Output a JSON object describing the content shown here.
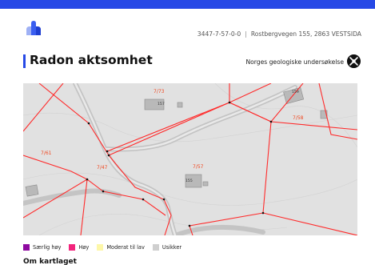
{
  "header": {
    "logo_icon": "cloud-bars-logo-icon",
    "property_id": "3447-7-57-0-0",
    "separator": "|",
    "address": "Rostbergvegen 155, 2863 VESTSIDA"
  },
  "section": {
    "title": "Radon aktsomhet",
    "source": "Norges geologiske undersøkelse",
    "source_icon": "ngu-logo-icon"
  },
  "map": {
    "parcel_labels": [
      "7/73",
      "7/58",
      "7/61",
      "7/47",
      "7/57"
    ],
    "building_labels": [
      "157",
      "159",
      "155"
    ],
    "boundary_color": "#ff2b2b",
    "label_color": "#f04a23",
    "background_color": "#e1e1e1"
  },
  "legend": {
    "items": [
      {
        "label": "Særlig høy",
        "color": "#8e0aa0"
      },
      {
        "label": "Høy",
        "color": "#f2247c"
      },
      {
        "label": "Moderat til lav",
        "color": "#fdf7a8"
      },
      {
        "label": "Usikker",
        "color": "#cfcfcf"
      }
    ]
  },
  "about": {
    "title": "Om kartlaget"
  }
}
